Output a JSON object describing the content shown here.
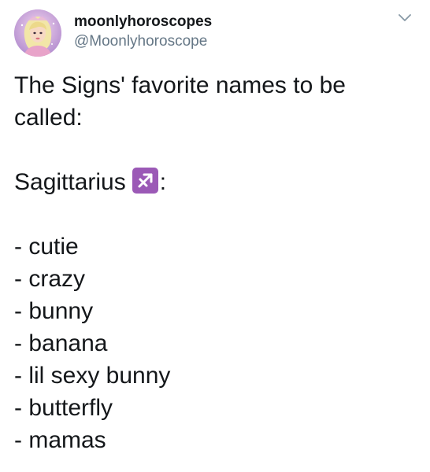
{
  "tweet": {
    "author": {
      "display_name": "moonlyhoroscopes",
      "handle": "@Moonlyhoroscope"
    },
    "text": {
      "intro_line1": "The Signs' favorite names to be",
      "intro_line2": "called:",
      "sign_name": "Sagittarius",
      "sign_emoji_icon": "sagittarius-symbol-icon",
      "sign_suffix": ":",
      "names": [
        "- cutie",
        "- crazy",
        "- bunny",
        "- banana",
        "- lil sexy bunny",
        "- butterfly",
        "- mamas"
      ]
    },
    "colors": {
      "text": "#14171a",
      "secondary_text": "#657786",
      "emoji_background": "#9b59b6"
    }
  }
}
